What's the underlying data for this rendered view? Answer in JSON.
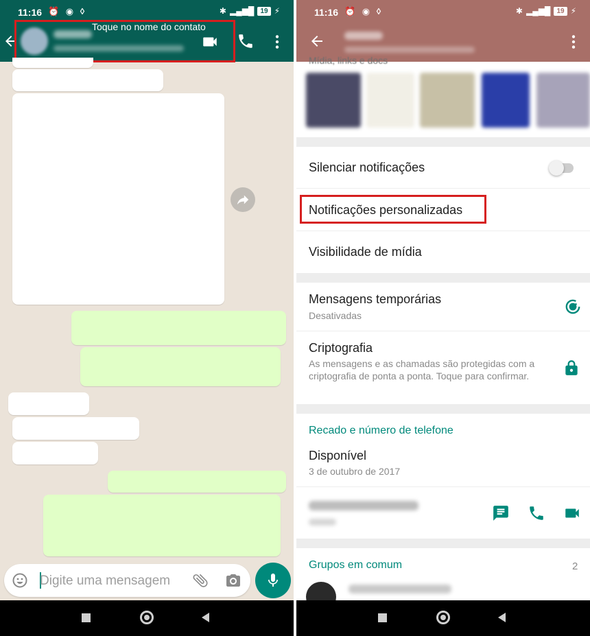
{
  "left_screen": {
    "status_bar": {
      "time": "11:16",
      "battery": "19"
    },
    "header": {
      "hint": "Toque no nome do contato"
    },
    "input": {
      "placeholder": "Digite uma mensagem"
    }
  },
  "right_screen": {
    "status_bar": {
      "time": "11:16",
      "battery": "19"
    },
    "media_label_partial": "Mídia, links e docs",
    "rows": {
      "mute": "Silenciar notificações",
      "custom_notifications": "Notificações personalizadas",
      "media_visibility": "Visibilidade de mídia",
      "temp_messages_title": "Mensagens temporárias",
      "temp_messages_sub": "Desativadas",
      "encryption_title": "Criptografia",
      "encryption_sub": "As mensagens e as chamadas são protegidas com a criptografia de ponta a ponta. Toque para confirmar."
    },
    "about_section": {
      "title": "Recado e número de telefone",
      "status": "Disponível",
      "date": "3 de outubro de 2017"
    },
    "groups_section": {
      "title": "Grupos em comum",
      "count": "2"
    }
  },
  "colors": {
    "left_header": "#075e54",
    "right_header": "#a86f68",
    "accent": "#00897b",
    "highlight_box": "#d61f1f",
    "outgoing_bubble": "#e1ffc7"
  },
  "icons": [
    "back-arrow-icon",
    "video-call-icon",
    "voice-call-icon",
    "more-vert-icon",
    "forward-icon",
    "emoji-icon",
    "attach-icon",
    "camera-icon",
    "mic-icon",
    "timer-icon",
    "lock-icon",
    "message-icon"
  ]
}
